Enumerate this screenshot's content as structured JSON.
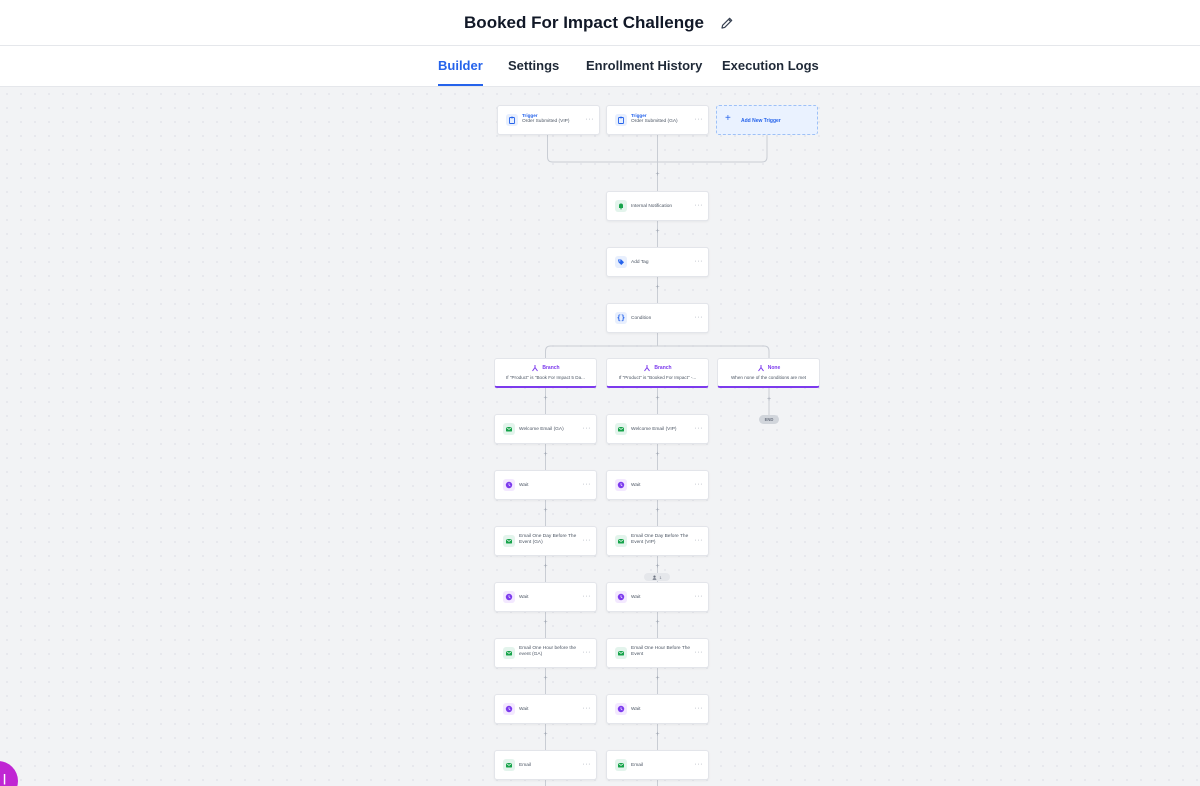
{
  "header": {
    "title": "Booked For Impact Challenge"
  },
  "tabs": [
    {
      "label": "Builder"
    },
    {
      "label": "Settings"
    },
    {
      "label": "Enrollment History"
    },
    {
      "label": "Execution Logs"
    }
  ],
  "triggers": [
    {
      "type": "Trigger",
      "label": "Order Submitted (VIP)"
    },
    {
      "type": "Trigger",
      "label": "Order Submitted (GA)"
    }
  ],
  "add_trigger_label": "Add New Trigger",
  "actions": {
    "internal_notification": "Internal Notification",
    "add_tag": "Add Tag",
    "condition": "Condition"
  },
  "branches": [
    {
      "title": "Branch",
      "desc": "If \"Product\" is \"Book For Impact 5 Da..."
    },
    {
      "title": "Branch",
      "desc": "If \"Product\" is \"Booked For Impact\" -..."
    },
    {
      "title": "None",
      "desc": "When none of the conditions are met"
    }
  ],
  "end_label": "END",
  "left_steps": [
    {
      "label": "Welcome Email (GA)",
      "kind": "email"
    },
    {
      "label": "Wait",
      "kind": "wait"
    },
    {
      "label": "Email One Day Before The Event (GA)",
      "kind": "email"
    },
    {
      "label": "Wait",
      "kind": "wait"
    },
    {
      "label": "Email One Hour before the event (GA)",
      "kind": "email"
    },
    {
      "label": "Wait",
      "kind": "wait"
    },
    {
      "label": "Email",
      "kind": "email"
    }
  ],
  "middle_steps": [
    {
      "label": "Welcome Email (VIP)",
      "kind": "email"
    },
    {
      "label": "Wait",
      "kind": "wait"
    },
    {
      "label": "Email One Day Before The Event (VIP)",
      "kind": "email"
    },
    {
      "label": "Wait",
      "kind": "wait"
    },
    {
      "label": "Email One Hour Before The Event",
      "kind": "email"
    },
    {
      "label": "Wait",
      "kind": "wait"
    },
    {
      "label": "Email",
      "kind": "email"
    }
  ],
  "contacts_chip_count": "1",
  "more_icon": "ellipsis-icon",
  "colors": {
    "accent": "#2563eb",
    "branch": "#7c3aed",
    "email_icon": "#16a34a",
    "wait_icon": "#7c3aed",
    "fab": "#c026d3"
  }
}
